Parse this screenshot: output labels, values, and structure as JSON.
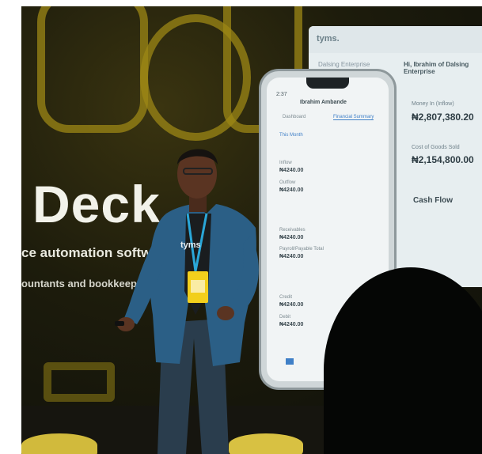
{
  "slide": {
    "title": "Deck",
    "tagline": "ce automation softwar",
    "subtag": "ountants and bookkeepers)"
  },
  "tablet": {
    "logo": "tyms.",
    "tab": "Dalsing Enterprise",
    "header": "Hi, Ibrahim of Dalsing Enterprise",
    "row1_label": "Money In (Inflow)",
    "row1_value": "₦2,807,380.20",
    "row2_label": "Cost of Goods Sold",
    "row2_value": "₦2,154,800.00",
    "section": "Cash Flow"
  },
  "phone": {
    "time": "2:37",
    "title": "Ibrahim Ambande",
    "tab1": "Dashboard",
    "tab2": "Financial Summary",
    "filter": "This Month",
    "rows": [
      {
        "label": "Inflow",
        "value": "₦4240.00"
      },
      {
        "label": "Outflow",
        "value": "₦4240.00"
      },
      {
        "label": "Receivables",
        "value": "₦4240.00"
      },
      {
        "label": "Payroll/Payable Total",
        "value": "₦4240.00"
      },
      {
        "label": "Credit",
        "value": "₦4240.00"
      },
      {
        "label": "Debit",
        "value": "₦4240.00"
      }
    ]
  },
  "badge": {
    "text": "tyms"
  },
  "colors": {
    "accent_gold": "#9c8716",
    "lanyard_blue": "#2aa7d8",
    "suit_blue": "#2b5f86"
  }
}
